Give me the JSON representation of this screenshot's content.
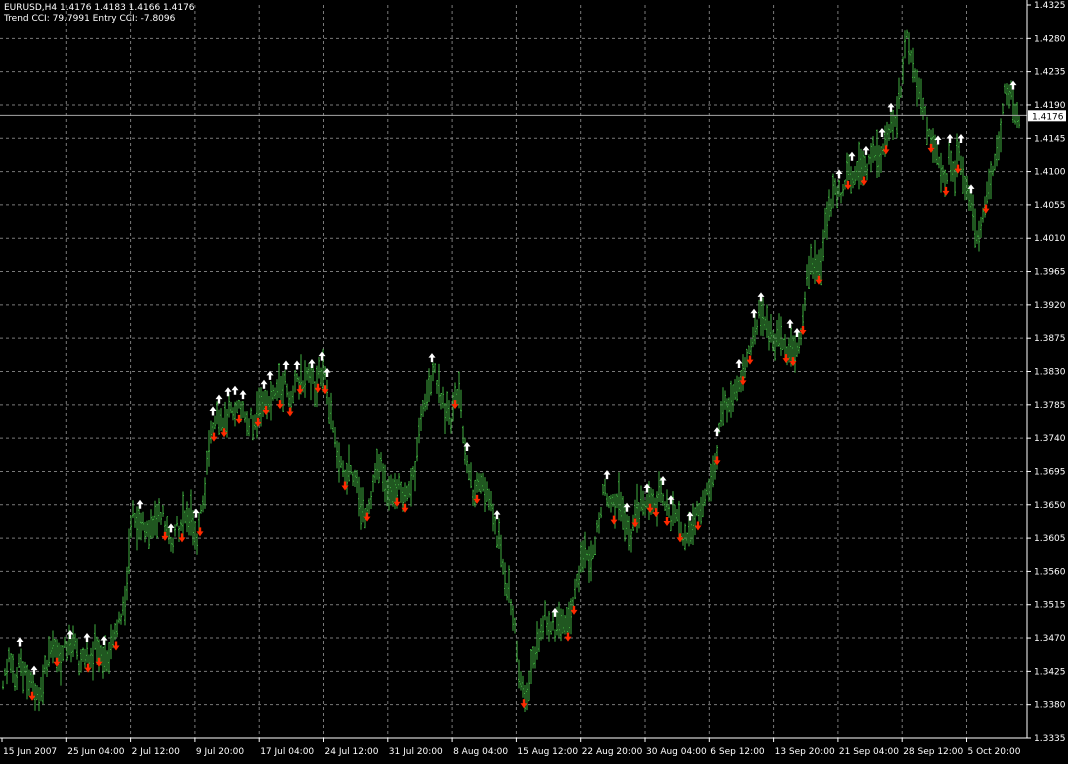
{
  "header": {
    "symbol_line": "EURUSD,H4  1.4176 1.4183 1.4166 1.4176",
    "indicator_line": "Trend CCI: 79.7991 Entry CCI: -7.8096"
  },
  "colors": {
    "background": "#000000",
    "grid": "#7a7a7a",
    "bars": "#3fae3f",
    "axis_text": "#ffffff",
    "up_arrow": "#ffffff",
    "down_arrow": "#ff2a00",
    "price_line": "#a6a6a6",
    "price_label_bg": "#ffffff",
    "price_label_text": "#000000"
  },
  "chart_data": {
    "type": "ohlc",
    "symbol": "EURUSD",
    "timeframe": "H4",
    "ylim": [
      1.3335,
      1.4325
    ],
    "y_ticks": [
      "1.4325",
      "1.4280",
      "1.4235",
      "1.4190",
      "1.4145",
      "1.4100",
      "1.4055",
      "1.4010",
      "1.3965",
      "1.3920",
      "1.3875",
      "1.3830",
      "1.3785",
      "1.3740",
      "1.3695",
      "1.3650",
      "1.3605",
      "1.3560",
      "1.3515",
      "1.3470",
      "1.3425",
      "1.3380",
      "1.3335"
    ],
    "x_ticks": [
      "15 Jun 2007",
      "25 Jun 04:00",
      "2 Jul 12:00",
      "9 Jul 20:00",
      "17 Jul 04:00",
      "24 Jul 12:00",
      "31 Jul 20:00",
      "8 Aug 04:00",
      "15 Aug 12:00",
      "22 Aug 20:00",
      "30 Aug 04:00",
      "6 Sep 12:00",
      "13 Sep 20:00",
      "21 Sep 04:00",
      "28 Sep 12:00",
      "5 Oct 20:00"
    ],
    "current_price": "1.4176",
    "price_path": [
      [
        0,
        1.339
      ],
      [
        5,
        1.342
      ],
      [
        10,
        1.344
      ],
      [
        15,
        1.341
      ],
      [
        20,
        1.344
      ],
      [
        25,
        1.342
      ],
      [
        30,
        1.341
      ],
      [
        35,
        1.34
      ],
      [
        40,
        1.339
      ],
      [
        45,
        1.343
      ],
      [
        50,
        1.345
      ],
      [
        55,
        1.346
      ],
      [
        60,
        1.344
      ],
      [
        65,
        1.346
      ],
      [
        70,
        1.345
      ],
      [
        75,
        1.346
      ],
      [
        80,
        1.344
      ],
      [
        85,
        1.345
      ],
      [
        90,
        1.344
      ],
      [
        95,
        1.346
      ],
      [
        100,
        1.345
      ],
      [
        105,
        1.344
      ],
      [
        110,
        1.346
      ],
      [
        115,
        1.347
      ],
      [
        120,
        1.349
      ],
      [
        125,
        1.352
      ],
      [
        128,
        1.356
      ],
      [
        130,
        1.361
      ],
      [
        133,
        1.364
      ],
      [
        137,
        1.362
      ],
      [
        142,
        1.363
      ],
      [
        147,
        1.361
      ],
      [
        152,
        1.362
      ],
      [
        157,
        1.363
      ],
      [
        162,
        1.364
      ],
      [
        167,
        1.361
      ],
      [
        172,
        1.359
      ],
      [
        177,
        1.362
      ],
      [
        182,
        1.362
      ],
      [
        187,
        1.364
      ],
      [
        192,
        1.363
      ],
      [
        197,
        1.361
      ],
      [
        202,
        1.364
      ],
      [
        207,
        1.37
      ],
      [
        210,
        1.374
      ],
      [
        215,
        1.376
      ],
      [
        220,
        1.377
      ],
      [
        225,
        1.376
      ],
      [
        230,
        1.379
      ],
      [
        235,
        1.378
      ],
      [
        240,
        1.378
      ],
      [
        245,
        1.377
      ],
      [
        250,
        1.376
      ],
      [
        255,
        1.377
      ],
      [
        260,
        1.378
      ],
      [
        265,
        1.379
      ],
      [
        270,
        1.38
      ],
      [
        275,
        1.381
      ],
      [
        280,
        1.38
      ],
      [
        285,
        1.382
      ],
      [
        290,
        1.379
      ],
      [
        295,
        1.381
      ],
      [
        300,
        1.382
      ],
      [
        305,
        1.381
      ],
      [
        310,
        1.382
      ],
      [
        315,
        1.381
      ],
      [
        320,
        1.383
      ],
      [
        325,
        1.382
      ],
      [
        330,
        1.378
      ],
      [
        335,
        1.374
      ],
      [
        340,
        1.37
      ],
      [
        345,
        1.369
      ],
      [
        350,
        1.371
      ],
      [
        355,
        1.368
      ],
      [
        360,
        1.366
      ],
      [
        365,
        1.364
      ],
      [
        370,
        1.366
      ],
      [
        375,
        1.369
      ],
      [
        380,
        1.37
      ],
      [
        385,
        1.368
      ],
      [
        390,
        1.367
      ],
      [
        395,
        1.366
      ],
      [
        400,
        1.368
      ],
      [
        405,
        1.366
      ],
      [
        410,
        1.367
      ],
      [
        415,
        1.37
      ],
      [
        420,
        1.375
      ],
      [
        425,
        1.38
      ],
      [
        430,
        1.382
      ],
      [
        435,
        1.383
      ],
      [
        440,
        1.38
      ],
      [
        445,
        1.378
      ],
      [
        450,
        1.376
      ],
      [
        455,
        1.38
      ],
      [
        460,
        1.381
      ],
      [
        465,
        1.372
      ],
      [
        470,
        1.368
      ],
      [
        475,
        1.366
      ],
      [
        480,
        1.369
      ],
      [
        485,
        1.366
      ],
      [
        490,
        1.365
      ],
      [
        495,
        1.362
      ],
      [
        500,
        1.36
      ],
      [
        505,
        1.356
      ],
      [
        510,
        1.352
      ],
      [
        515,
        1.348
      ],
      [
        520,
        1.342
      ],
      [
        525,
        1.339
      ],
      [
        530,
        1.341
      ],
      [
        535,
        1.344
      ],
      [
        540,
        1.348
      ],
      [
        545,
        1.35
      ],
      [
        550,
        1.349
      ],
      [
        555,
        1.348
      ],
      [
        560,
        1.35
      ],
      [
        565,
        1.348
      ],
      [
        570,
        1.349
      ],
      [
        575,
        1.353
      ],
      [
        580,
        1.356
      ],
      [
        585,
        1.358
      ],
      [
        590,
        1.357
      ],
      [
        595,
        1.36
      ],
      [
        600,
        1.364
      ],
      [
        605,
        1.367
      ],
      [
        610,
        1.366
      ],
      [
        615,
        1.364
      ],
      [
        620,
        1.366
      ],
      [
        625,
        1.363
      ],
      [
        630,
        1.361
      ],
      [
        635,
        1.364
      ],
      [
        640,
        1.365
      ],
      [
        645,
        1.364
      ],
      [
        650,
        1.366
      ],
      [
        655,
        1.365
      ],
      [
        660,
        1.367
      ],
      [
        665,
        1.365
      ],
      [
        670,
        1.363
      ],
      [
        675,
        1.364
      ],
      [
        680,
        1.362
      ],
      [
        685,
        1.36
      ],
      [
        690,
        1.361
      ],
      [
        695,
        1.363
      ],
      [
        700,
        1.364
      ],
      [
        705,
        1.366
      ],
      [
        710,
        1.368
      ],
      [
        715,
        1.37
      ],
      [
        720,
        1.376
      ],
      [
        725,
        1.379
      ],
      [
        730,
        1.379
      ],
      [
        735,
        1.38
      ],
      [
        740,
        1.382
      ],
      [
        745,
        1.384
      ],
      [
        750,
        1.386
      ],
      [
        755,
        1.389
      ],
      [
        760,
        1.391
      ],
      [
        765,
        1.389
      ],
      [
        770,
        1.388
      ],
      [
        775,
        1.387
      ],
      [
        780,
        1.388
      ],
      [
        785,
        1.386
      ],
      [
        790,
        1.387
      ],
      [
        795,
        1.385
      ],
      [
        800,
        1.387
      ],
      [
        805,
        1.392
      ],
      [
        808,
        1.397
      ],
      [
        812,
        1.398
      ],
      [
        817,
        1.396
      ],
      [
        822,
        1.398
      ],
      [
        826,
        1.404
      ],
      [
        830,
        1.406
      ],
      [
        835,
        1.408
      ],
      [
        840,
        1.407
      ],
      [
        845,
        1.409
      ],
      [
        850,
        1.41
      ],
      [
        855,
        1.409
      ],
      [
        860,
        1.411
      ],
      [
        865,
        1.41
      ],
      [
        870,
        1.412
      ],
      [
        875,
        1.413
      ],
      [
        880,
        1.412
      ],
      [
        885,
        1.414
      ],
      [
        890,
        1.416
      ],
      [
        895,
        1.417
      ],
      [
        900,
        1.42
      ],
      [
        905,
        1.427
      ],
      [
        908,
        1.428
      ],
      [
        912,
        1.424
      ],
      [
        917,
        1.423
      ],
      [
        922,
        1.42
      ],
      [
        926,
        1.417
      ],
      [
        930,
        1.415
      ],
      [
        935,
        1.413
      ],
      [
        940,
        1.411
      ],
      [
        945,
        1.408
      ],
      [
        950,
        1.412
      ],
      [
        955,
        1.41
      ],
      [
        960,
        1.413
      ],
      [
        965,
        1.408
      ],
      [
        970,
        1.406
      ],
      [
        975,
        1.402
      ],
      [
        980,
        1.401
      ],
      [
        985,
        1.406
      ],
      [
        990,
        1.408
      ],
      [
        995,
        1.412
      ],
      [
        1000,
        1.415
      ],
      [
        1005,
        1.42
      ],
      [
        1010,
        1.421
      ],
      [
        1015,
        1.418
      ],
      [
        1020,
        1.4176
      ]
    ],
    "up_arrow_x": [
      20,
      34,
      70,
      87,
      104,
      140,
      171,
      196,
      213,
      219,
      228,
      235,
      243,
      264,
      270,
      286,
      297,
      312,
      322,
      327,
      432,
      467,
      497,
      555,
      607,
      627,
      647,
      663,
      671,
      690,
      717,
      739,
      754,
      761,
      790,
      797,
      839,
      852,
      866,
      882,
      891,
      938,
      950,
      961,
      971,
      1013
    ],
    "down_arrow_x": [
      32,
      57,
      88,
      99,
      116,
      165,
      182,
      200,
      214,
      224,
      239,
      258,
      266,
      280,
      290,
      300,
      318,
      325,
      345,
      367,
      397,
      405,
      455,
      477,
      524,
      568,
      574,
      614,
      635,
      650,
      656,
      667,
      680,
      698,
      717,
      743,
      750,
      786,
      793,
      803,
      819,
      848,
      864,
      886,
      931,
      946,
      958,
      986
    ]
  }
}
